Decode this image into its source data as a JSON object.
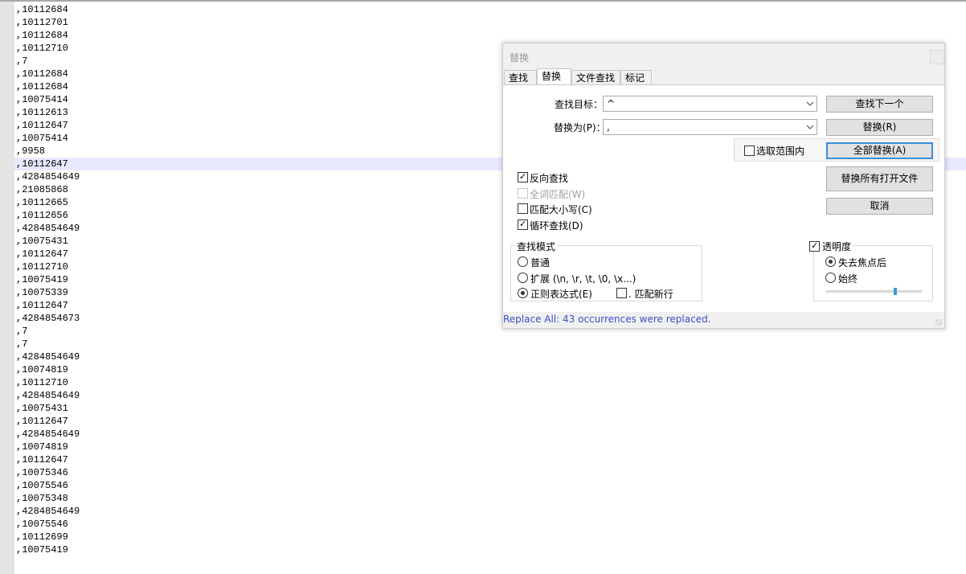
{
  "editor": {
    "lines": [
      ",10112684",
      ",10112701",
      ",10112684",
      ",10112710",
      ",7",
      ",10112684",
      ",10112684",
      ",10075414",
      ",10112613",
      ",10112647",
      ",10075414",
      ",9958",
      ",10112647",
      ",4284854649",
      ",21085868",
      ",10112665",
      ",10112656",
      ",4284854649",
      ",10075431",
      ",10112647",
      ",10112710",
      ",10075419",
      ",10075339",
      ",10112647",
      ",4284854673",
      ",7",
      ",7",
      ",4284854649",
      ",10074819",
      ",10112710",
      ",4284854649",
      ",10075431",
      ",10112647",
      ",4284854649",
      ",10074819",
      ",10112647",
      ",10075346",
      ",10075546",
      ",10075348",
      ",4284854649",
      ",10075546",
      ",10112699",
      ",10075419"
    ],
    "current_line_index": 12,
    "current_line_color": "#e8e8ff"
  },
  "dialog": {
    "title": "替换",
    "tabs": [
      {
        "label": "查找"
      },
      {
        "label": "替换",
        "active": true
      },
      {
        "label": "文件查找"
      },
      {
        "label": "标记"
      }
    ],
    "find_label": "查找目标：",
    "find_value": "^",
    "replace_label": "替换为(P)：",
    "replace_value": ",",
    "buttons": {
      "find_next": "查找下一个",
      "replace": "替换(R)",
      "replace_all": "全部替换(A)",
      "replace_all_open": "替换所有打开文件",
      "cancel": "取消"
    },
    "in_selection": {
      "label": "选取范围内",
      "checked": false
    },
    "options": [
      {
        "label": "反向查找",
        "checked": true,
        "disabled": false
      },
      {
        "label": "全词匹配(W)",
        "checked": false,
        "disabled": true
      },
      {
        "label": "匹配大小写(C)",
        "checked": false,
        "disabled": false
      },
      {
        "label": "循环查找(D)",
        "checked": true,
        "disabled": false
      }
    ],
    "search_mode": {
      "title": "查找模式",
      "options": [
        {
          "label": "普通",
          "selected": false
        },
        {
          "label": "扩展 (\\n, \\r, \\t, \\0, \\x...)",
          "selected": false
        },
        {
          "label": "正则表达式(E)",
          "selected": true
        }
      ],
      "dot_newline": {
        "label": ". 匹配新行",
        "checked": false
      }
    },
    "transparency": {
      "title": "透明度",
      "checked": true,
      "options": [
        {
          "label": "失去焦点后",
          "selected": true
        },
        {
          "label": "始终",
          "selected": false
        }
      ],
      "level": 0.72
    },
    "status": "Replace All: 43 occurrences were replaced.",
    "status_color": "#3a50c8"
  }
}
